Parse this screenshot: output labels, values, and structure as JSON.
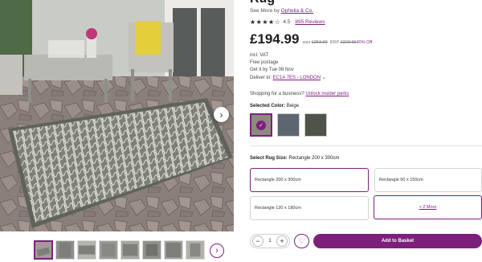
{
  "product": {
    "title": "Rug",
    "see_more_prefix": "See More by",
    "brand": "Ophelia & Co.",
    "stars": "★★★★☆",
    "rating": "4.5",
    "reviews": "895 Reviews",
    "price": "£194.99",
    "was_label": "was",
    "was_price": "£253.99",
    "rrp_label": "RRP",
    "rrp_price": "£323.65",
    "saving": "40% Off",
    "vat": "incl. VAT",
    "postage": "Free postage",
    "get_it": "Get it by Tue 08 Nov",
    "deliver_prefix": "Deliver to:",
    "deliver_location": "EC1A 7ES - LONDON",
    "business_prefix": "Shopping for a business?",
    "business_link": "Unlock insider perks"
  },
  "color_select": {
    "label": "Selected Color:",
    "value": "Beige",
    "swatches": [
      "#8e8a80",
      "#5d6670",
      "#4e5449"
    ]
  },
  "size_select": {
    "label": "Select Rug Size:",
    "value": "Rectangle 200 x 300cm",
    "options": [
      "Rectangle 200 x 300cm",
      "Rectangle 90 x 150cm",
      "Rectangle 120 x 180cm"
    ],
    "more": "+ 2 More"
  },
  "basket": {
    "qty": "1",
    "minus": "−",
    "plus": "+",
    "heart": "♡",
    "add_label": "Add to Basket"
  },
  "gallery": {
    "next_icon": "›"
  },
  "colors": {
    "accent": "#7d1f7d"
  }
}
